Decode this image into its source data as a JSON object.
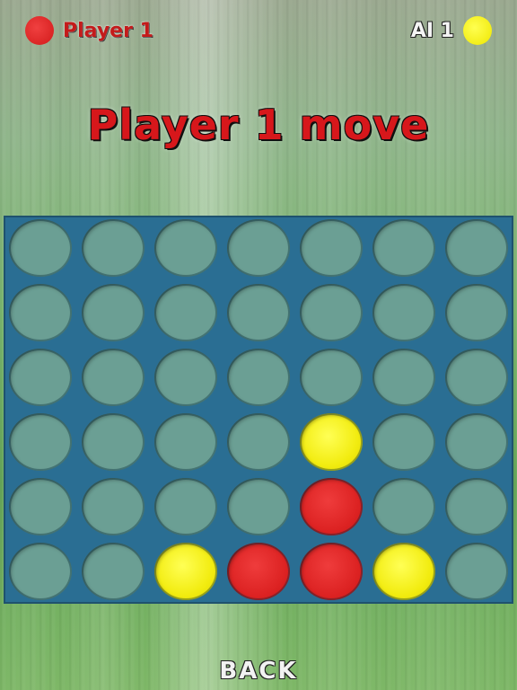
{
  "header": {
    "player_label": "Player 1",
    "ai_label": "AI 1",
    "player_color": "#d21a1a",
    "ai_color": "#eee600"
  },
  "status": {
    "title": "Player 1 move"
  },
  "board": {
    "rows": 6,
    "cols": 7,
    "cells": [
      [
        "empty",
        "empty",
        "empty",
        "empty",
        "empty",
        "empty",
        "empty"
      ],
      [
        "empty",
        "empty",
        "empty",
        "empty",
        "empty",
        "empty",
        "empty"
      ],
      [
        "empty",
        "empty",
        "empty",
        "empty",
        "empty",
        "empty",
        "empty"
      ],
      [
        "empty",
        "empty",
        "empty",
        "empty",
        "yellow",
        "empty",
        "empty"
      ],
      [
        "empty",
        "empty",
        "empty",
        "empty",
        "red",
        "empty",
        "empty"
      ],
      [
        "empty",
        "empty",
        "yellow",
        "red",
        "red",
        "yellow",
        "empty"
      ]
    ]
  },
  "footer": {
    "back_label": "BACK"
  }
}
